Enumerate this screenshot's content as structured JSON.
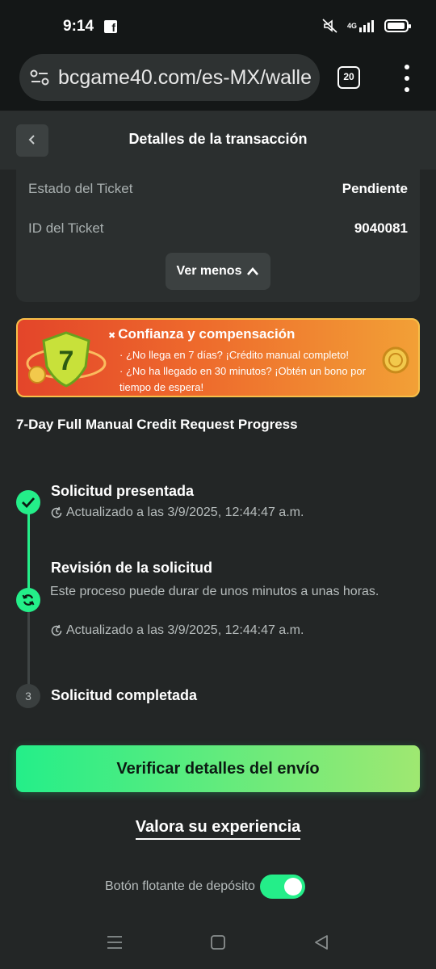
{
  "status_bar": {
    "time": "9:14",
    "signal_text": "4G",
    "icons": [
      "facebook-icon",
      "mute-icon",
      "signal-icon",
      "battery-icon"
    ]
  },
  "browser": {
    "url": "bcgame40.com/es-MX/walle",
    "tab_count": "20"
  },
  "header": {
    "title": "Detalles de la transacción"
  },
  "details": [
    {
      "label": "Estado del Ticket",
      "value": "Pendiente"
    },
    {
      "label": "ID del Ticket",
      "value": "9040081"
    }
  ],
  "ver_menos_label": "Ver menos",
  "banner": {
    "title": "Confianza y compensación",
    "line1": "· ¿No llega en 7 días? ¡Crédito manual completo!",
    "line2": "· ¿No ha llegado en 30 minutos? ¡Obtén un bono por",
    "line3": "tiempo de espera!",
    "badge_number": "7"
  },
  "progress": {
    "title": "7-Day Full Manual Credit Request Progress",
    "steps": [
      {
        "title": "Solicitud presentada",
        "time": "Actualizado a las 3/9/2025, 12:44:47 a.m.",
        "status": "done"
      },
      {
        "title": "Revisión de la solicitud",
        "description": "Este proceso puede durar de unos minutos a unas horas.",
        "time": "Actualizado a las 3/9/2025, 12:44:47 a.m.",
        "status": "in-progress"
      },
      {
        "number": "3",
        "title": "Solicitud completada",
        "status": "pending"
      }
    ]
  },
  "verify_button": "Verificar detalles del envío",
  "rate_link": "Valora su experiencia",
  "toggle": {
    "label": "Botón flotante de depósito",
    "checked": true
  },
  "colors": {
    "accent": "#24ee89",
    "background": "#232626",
    "card": "#2b2f2f"
  }
}
